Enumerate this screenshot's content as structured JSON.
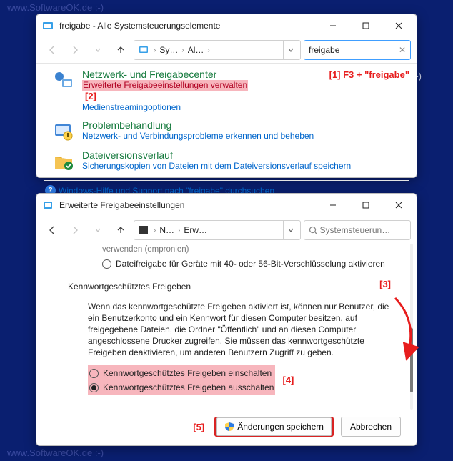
{
  "watermark": "www.SoftwareOK.de :-)",
  "window1": {
    "title": "freigabe - Alle Systemsteuerungselemente",
    "breadcrumb": {
      "p1": "Sy…",
      "p2": "Al…"
    },
    "search_value": "freigabe",
    "marker1": "[1] F3 + \"freigabe\"",
    "marker2": "[2]",
    "results": [
      {
        "title": "Netzwerk- und Freigabecenter",
        "line1": "Erweiterte Freigabeeinstellungen verwalten",
        "line2": "Medienstreamingoptionen"
      },
      {
        "title": "Problembehandlung",
        "line1": "Netzwerk- und Verbindungsprobleme erkennen und beheben"
      },
      {
        "title": "Dateiversionsverlauf",
        "line1": "Sicherungskopien von Dateien mit dem Dateiversionsverlauf speichern"
      }
    ],
    "help": "Windows-Hilfe und Support nach \"freigabe\" durchsuchen"
  },
  "window2": {
    "title": "Erweiterte Freigabeeinstellungen",
    "breadcrumb": {
      "p1": "N…",
      "p2": "Erw…"
    },
    "search_placeholder": "Systemsteuerun…",
    "cut_top": "verwenden (empronien)",
    "radio_encrypt": "Dateifreigabe für Geräte mit 40- oder 56-Bit-Verschlüsselung aktivieren",
    "section": "Kennwortgeschütztes Freigeben",
    "para": "Wenn das kennwortgeschützte Freigeben aktiviert ist, können nur Benutzer, die ein Benutzerkonto und ein Kennwort für diesen Computer besitzen, auf freigegebene Dateien, die Ordner \"Öffentlich\" und an diesen Computer angeschlossene Drucker zugreifen. Sie müssen das kennwortgeschützte Freigeben deaktivieren, um anderen Benutzern Zugriff zu geben.",
    "radio_on": "Kennwortgeschütztes Freigeben einschalten",
    "radio_off": "Kennwortgeschütztes Freigeben ausschalten",
    "marker3": "[3]",
    "marker4": "[4]",
    "marker5": "[5]",
    "save": "Änderungen speichern",
    "cancel": "Abbrechen"
  }
}
